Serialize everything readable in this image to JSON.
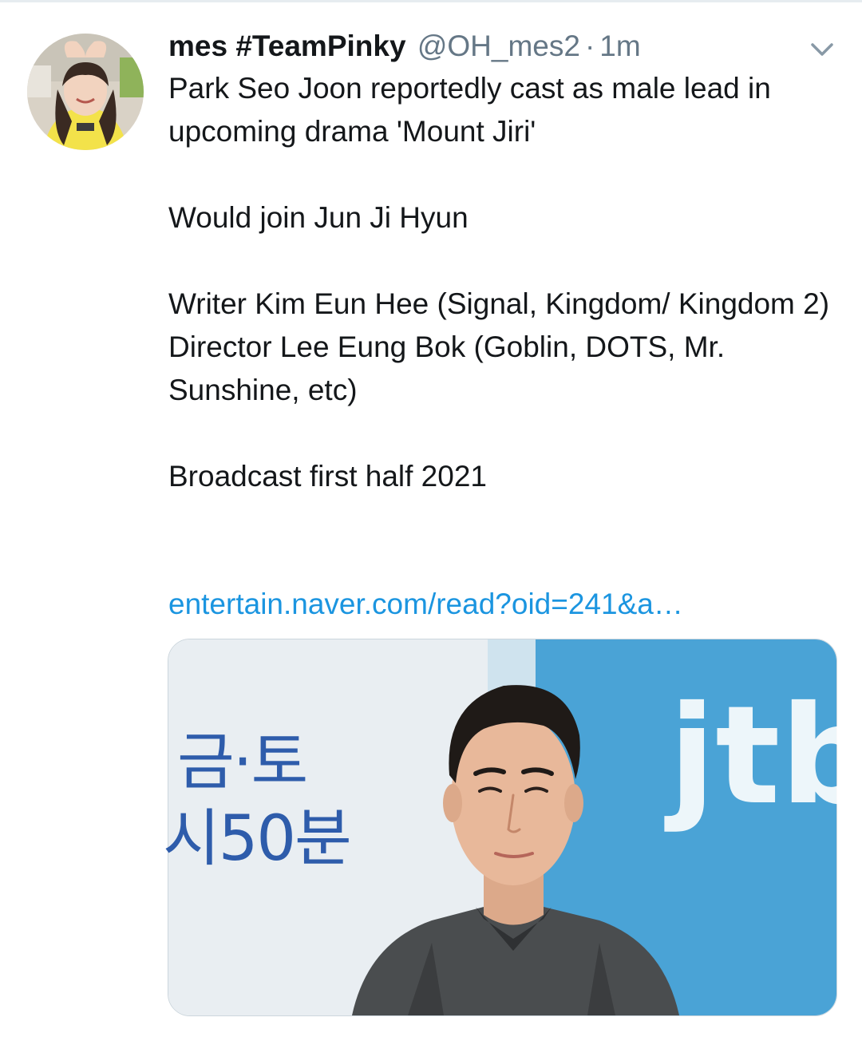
{
  "tweet": {
    "display_name": "mes #TeamPinky",
    "handle": "@OH_mes2",
    "separator": "·",
    "time": "1m",
    "text_lines": [
      "Park Seo Joon reportedly cast as male lead in upcoming drama 'Mount Jiri'",
      "Would join Jun Ji Hyun",
      "Writer Kim Eun Hee (Signal, Kingdom/ Kingdom 2)",
      "Director Lee Eung Bok (Goblin, DOTS, Mr. Sunshine, etc)",
      "Broadcast first half 2021"
    ],
    "link_text": "entertain.naver.com/read?oid=241&a…"
  },
  "card_image": {
    "backdrop_text_line1": "금·토",
    "backdrop_text_line2": "시50분",
    "backdrop_logo": "jtb"
  },
  "icons": {
    "caret": "chevron-down-icon"
  },
  "colors": {
    "text": "#14171a",
    "secondary": "#657786",
    "link": "#1b95e0",
    "card_border": "#ccd6dd",
    "backdrop_blue": "#4aa3d6"
  }
}
